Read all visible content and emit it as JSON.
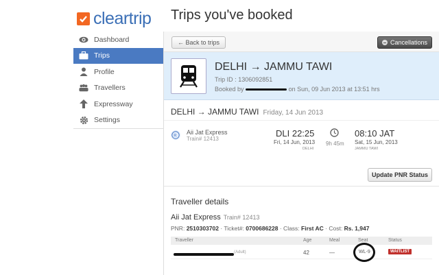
{
  "header": {
    "logo_text": "cleartrip",
    "page_title": "Trips you've booked",
    "brand_color": "#f26722",
    "logo_color": "#3b6fb6"
  },
  "sidebar": {
    "items": [
      {
        "label": "Dashboard",
        "icon": "eye-icon",
        "active": false
      },
      {
        "label": "Trips",
        "icon": "suitcase-icon",
        "active": true
      },
      {
        "label": "Profile",
        "icon": "person-icon",
        "active": false
      },
      {
        "label": "Travellers",
        "icon": "people-icon",
        "active": false
      },
      {
        "label": "Expressway",
        "icon": "arrow-up-icon",
        "active": false
      },
      {
        "label": "Settings",
        "icon": "gear-icon",
        "active": false
      }
    ],
    "active_color": "#4a7ac2"
  },
  "toolbar": {
    "back_label": "← Back to trips",
    "cancel_label": "Cancellations"
  },
  "trip": {
    "route": "DELHI → JAMMU TAWI",
    "trip_id_label": "Trip ID :",
    "trip_id": "1306092851",
    "booked_by_label": "Booked by",
    "booked_on": "on Sun, 09 Jun 2013 at 13:51 hrs"
  },
  "journey": {
    "route": "DELHI → JAMMU TAWI",
    "date": "Friday, 14 Jun 2013",
    "train_name": "Aii Jat Express",
    "train_no": "Train# 12413",
    "dep_time": "DLI 22:25",
    "dep_date": "Fri, 14 Jun, 2013",
    "dep_station": "DELHI",
    "duration": "9h 45m",
    "arr_time": "08:10 JAT",
    "arr_date": "Sat, 15 Jun, 2013",
    "arr_station": "JAMMU TAWI",
    "pnr_button": "Update PNR Status"
  },
  "travellers": {
    "title": "Traveller details",
    "train_name": "Aii Jat Express",
    "train_no": "Train# 12413",
    "pnr_label": "PNR:",
    "pnr": "2510303702",
    "ticket_label": "· Ticket#:",
    "ticket": "0700686228",
    "class_label": "· Class:",
    "class": "First AC",
    "cost_label": "· Cost:",
    "cost": "Rs. 1,947",
    "columns": [
      "Traveller",
      "Age",
      "Meal",
      "Seat",
      "Status"
    ],
    "rows": [
      {
        "type": "(Adult)",
        "age": "42",
        "meal": "—",
        "seat": "WL-9",
        "status": "WAITLIST"
      }
    ],
    "waitlist_color": "#c0302c"
  }
}
